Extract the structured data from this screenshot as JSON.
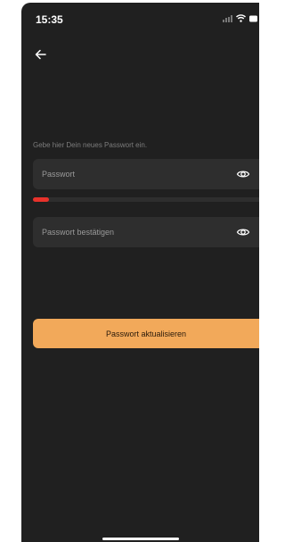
{
  "status_bar": {
    "time": "15:35",
    "icons": [
      "cellular-signal-icon",
      "wifi-icon",
      "battery-icon"
    ]
  },
  "nav": {
    "back_icon": "arrow-left-icon"
  },
  "form": {
    "instruction": "Gebe hier Dein neues Passwort ein.",
    "password": {
      "value": "",
      "placeholder": "Passwort",
      "toggle_icon": "eye-icon"
    },
    "password_strength": {
      "level": 0.07,
      "color": "#e8322b"
    },
    "confirm": {
      "value": "",
      "placeholder": "Passwort bestätigen",
      "toggle_icon": "eye-icon"
    }
  },
  "submit_button": {
    "label": "Passwort aktualisieren"
  },
  "colors": {
    "background": "#202020",
    "field": "#2e2e2e",
    "accent": "#f2a95a",
    "strength_low": "#e8322b"
  }
}
